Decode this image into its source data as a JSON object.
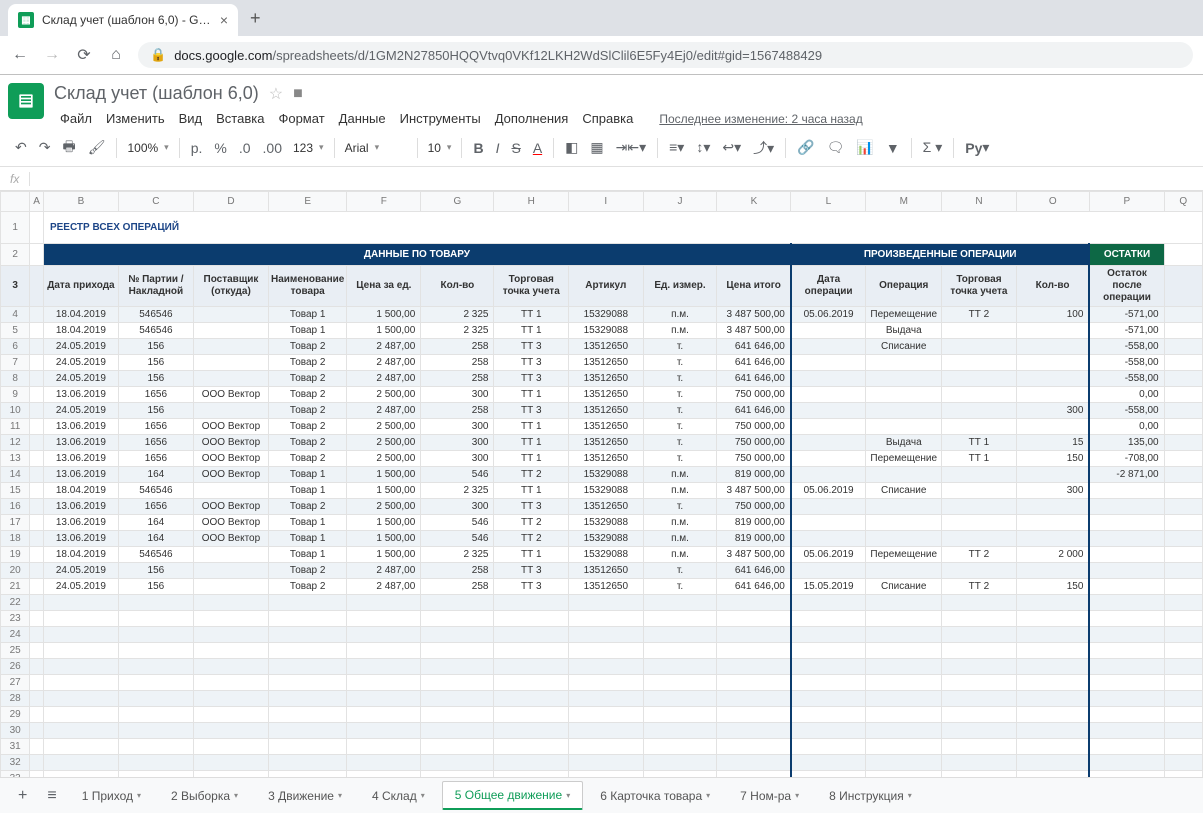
{
  "browser": {
    "tab_title": "Склад учет (шаблон 6,0) - Goog",
    "url_host": "docs.google.com",
    "url_path": "/spreadsheets/d/1GM2N27850HQQVtvq0VKf12LKH2WdSlClil6E5Fy4Ej0/edit#gid=1567488429"
  },
  "doc": {
    "title": "Склад учет (шаблон 6,0)",
    "last_edit": "Последнее изменение: 2 часа назад"
  },
  "menus": [
    "Файл",
    "Изменить",
    "Вид",
    "Вставка",
    "Формат",
    "Данные",
    "Инструменты",
    "Дополнения",
    "Справка"
  ],
  "toolbar": {
    "zoom": "100%",
    "currency": "р.",
    "pct": "%",
    "dec_dec": ".0",
    "dec_inc": ".00",
    "numfmt": "123",
    "font": "Arial",
    "size": "10"
  },
  "fx": "fx",
  "columns": [
    "",
    "A",
    "B",
    "C",
    "D",
    "E",
    "F",
    "G",
    "H",
    "I",
    "J",
    "K",
    "L",
    "M",
    "N",
    "O",
    "P",
    "Q"
  ],
  "sheet_title": "РЕЕСТР ВСЕХ ОПЕРАЦИЙ",
  "bands": {
    "goods": "ДАННЫЕ ПО ТОВАРУ",
    "ops": "ПРОИЗВЕДЕННЫЕ ОПЕРАЦИИ",
    "rest": "ОСТАТКИ"
  },
  "headers": [
    "Дата прихода",
    "№ Партии / Накладной",
    "Поставщик (откуда)",
    "Наименование товара",
    "Цена за ед.",
    "Кол-во",
    "Торговая точка учета",
    "Артикул",
    "Ед. измер.",
    "Цена итого",
    "Дата операции",
    "Операция",
    "Торговая точка учета",
    "Кол-во",
    "Остаток после операции"
  ],
  "rows": [
    {
      "r": 4,
      "d": [
        "18.04.2019",
        "546546",
        "",
        "Товар 1",
        "1 500,00",
        "2 325",
        "ТТ 1",
        "15329088",
        "п.м.",
        "3 487 500,00",
        "05.06.2019",
        "Перемещение",
        "ТТ 2",
        "100",
        "-571,00"
      ]
    },
    {
      "r": 5,
      "d": [
        "18.04.2019",
        "546546",
        "",
        "Товар 1",
        "1 500,00",
        "2 325",
        "ТТ 1",
        "15329088",
        "п.м.",
        "3 487 500,00",
        "",
        "Выдача",
        "",
        "",
        "-571,00"
      ]
    },
    {
      "r": 6,
      "d": [
        "24.05.2019",
        "156",
        "",
        "Товар 2",
        "2 487,00",
        "258",
        "ТТ 3",
        "13512650",
        "т.",
        "641 646,00",
        "",
        "Списание",
        "",
        "",
        "-558,00"
      ]
    },
    {
      "r": 7,
      "d": [
        "24.05.2019",
        "156",
        "",
        "Товар 2",
        "2 487,00",
        "258",
        "ТТ 3",
        "13512650",
        "т.",
        "641 646,00",
        "",
        "",
        "",
        "",
        "-558,00"
      ]
    },
    {
      "r": 8,
      "d": [
        "24.05.2019",
        "156",
        "",
        "Товар 2",
        "2 487,00",
        "258",
        "ТТ 3",
        "13512650",
        "т.",
        "641 646,00",
        "",
        "",
        "",
        "",
        "-558,00"
      ]
    },
    {
      "r": 9,
      "d": [
        "13.06.2019",
        "1656",
        "ООО Вектор",
        "Товар 2",
        "2 500,00",
        "300",
        "ТТ 1",
        "13512650",
        "т.",
        "750 000,00",
        "",
        "",
        "",
        "",
        "0,00"
      ]
    },
    {
      "r": 10,
      "d": [
        "24.05.2019",
        "156",
        "",
        "Товар 2",
        "2 487,00",
        "258",
        "ТТ 3",
        "13512650",
        "т.",
        "641 646,00",
        "",
        "",
        "",
        "300",
        "-558,00"
      ]
    },
    {
      "r": 11,
      "d": [
        "13.06.2019",
        "1656",
        "ООО Вектор",
        "Товар 2",
        "2 500,00",
        "300",
        "ТТ 1",
        "13512650",
        "т.",
        "750 000,00",
        "",
        "",
        "",
        "",
        "0,00"
      ]
    },
    {
      "r": 12,
      "d": [
        "13.06.2019",
        "1656",
        "ООО Вектор",
        "Товар 2",
        "2 500,00",
        "300",
        "ТТ 1",
        "13512650",
        "т.",
        "750 000,00",
        "",
        "Выдача",
        "ТТ 1",
        "15",
        "135,00"
      ]
    },
    {
      "r": 13,
      "d": [
        "13.06.2019",
        "1656",
        "ООО Вектор",
        "Товар 2",
        "2 500,00",
        "300",
        "ТТ 1",
        "13512650",
        "т.",
        "750 000,00",
        "",
        "Перемещение",
        "ТТ 1",
        "150",
        "-708,00"
      ]
    },
    {
      "r": 14,
      "d": [
        "13.06.2019",
        "164",
        "ООО Вектор",
        "Товар 1",
        "1 500,00",
        "546",
        "ТТ 2",
        "15329088",
        "п.м.",
        "819 000,00",
        "",
        "",
        "",
        "",
        "-2 871,00"
      ]
    },
    {
      "r": 15,
      "d": [
        "18.04.2019",
        "546546",
        "",
        "Товар 1",
        "1 500,00",
        "2 325",
        "ТТ 1",
        "15329088",
        "п.м.",
        "3 487 500,00",
        "05.06.2019",
        "Списание",
        "",
        "300",
        ""
      ]
    },
    {
      "r": 16,
      "d": [
        "13.06.2019",
        "1656",
        "ООО Вектор",
        "Товар 2",
        "2 500,00",
        "300",
        "ТТ 3",
        "13512650",
        "т.",
        "750 000,00",
        "",
        "",
        "",
        "",
        ""
      ]
    },
    {
      "r": 17,
      "d": [
        "13.06.2019",
        "164",
        "ООО Вектор",
        "Товар 1",
        "1 500,00",
        "546",
        "ТТ 2",
        "15329088",
        "п.м.",
        "819 000,00",
        "",
        "",
        "",
        "",
        ""
      ]
    },
    {
      "r": 18,
      "d": [
        "13.06.2019",
        "164",
        "ООО Вектор",
        "Товар 1",
        "1 500,00",
        "546",
        "ТТ 2",
        "15329088",
        "п.м.",
        "819 000,00",
        "",
        "",
        "",
        "",
        ""
      ]
    },
    {
      "r": 19,
      "d": [
        "18.04.2019",
        "546546",
        "",
        "Товар 1",
        "1 500,00",
        "2 325",
        "ТТ 1",
        "15329088",
        "п.м.",
        "3 487 500,00",
        "05.06.2019",
        "Перемещение",
        "ТТ 2",
        "2 000",
        ""
      ]
    },
    {
      "r": 20,
      "d": [
        "24.05.2019",
        "156",
        "",
        "Товар 2",
        "2 487,00",
        "258",
        "ТТ 3",
        "13512650",
        "т.",
        "641 646,00",
        "",
        "",
        "",
        "",
        ""
      ]
    },
    {
      "r": 21,
      "d": [
        "24.05.2019",
        "156",
        "",
        "Товар 2",
        "2 487,00",
        "258",
        "ТТ 3",
        "13512650",
        "т.",
        "641 646,00",
        "15.05.2019",
        "Списание",
        "ТТ 2",
        "150",
        ""
      ]
    }
  ],
  "empty_rows": [
    22,
    23,
    24,
    25,
    26,
    27,
    28,
    29,
    30,
    31,
    32,
    33
  ],
  "tabs": [
    "1 Приход",
    "2 Выборка",
    "3 Движение",
    "4 Склад",
    "5 Общее движение",
    "6 Карточка товара",
    "7 Ном-ра",
    "8 Инструкция"
  ],
  "active_tab": 4
}
